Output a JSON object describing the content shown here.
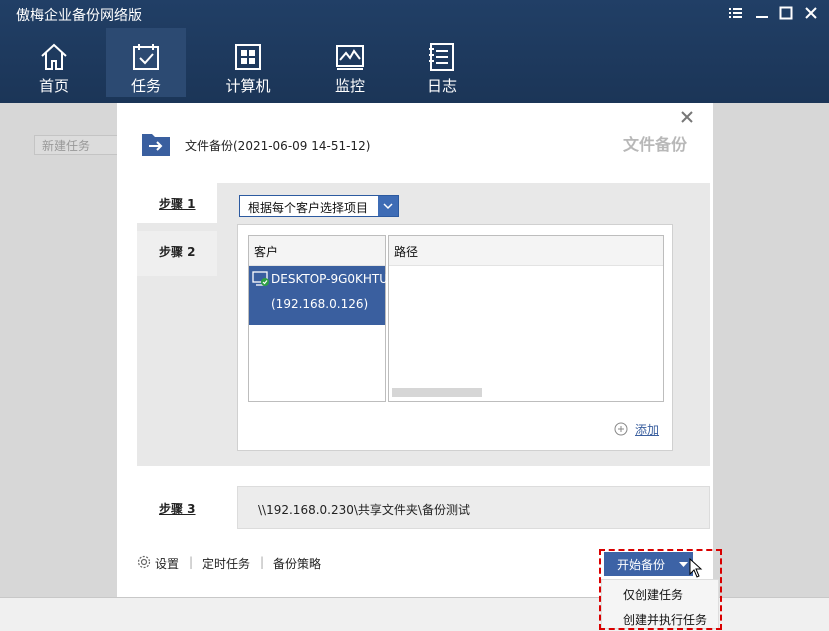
{
  "app": {
    "title": "傲梅企业备份网络版",
    "window_controls": [
      "menu",
      "minimize",
      "maximize",
      "close"
    ]
  },
  "nav": {
    "items": [
      {
        "label": "首页",
        "icon": "home-icon",
        "active": false
      },
      {
        "label": "任务",
        "icon": "task-icon",
        "active": true
      },
      {
        "label": "计算机",
        "icon": "computer-icon",
        "active": false
      },
      {
        "label": "监控",
        "icon": "monitor-icon",
        "active": false
      },
      {
        "label": "日志",
        "icon": "log-icon",
        "active": false
      }
    ]
  },
  "background": {
    "new_task_placeholder": "新建任务"
  },
  "dialog": {
    "corner_title": "文件备份",
    "task_name": "文件备份(2021-06-09 14-51-12)",
    "steps": {
      "step1_label": "步骤 1",
      "step2_label": "步骤 2",
      "step3_label": "步骤 3"
    },
    "mode_select": {
      "selected": "根据每个客户选择项目"
    },
    "client_table": {
      "header": "客户",
      "rows": [
        {
          "name": "DESKTOP-9G0KHTU",
          "ip": "(192.168.0.126)",
          "selected": true
        }
      ]
    },
    "path_table": {
      "header": "路径"
    },
    "add_label": "添加",
    "destination": "\\\\192.168.0.230\\共享文件夹\\备份测试",
    "footer": {
      "settings": "设置",
      "schedule": "定时任务",
      "strategy": "备份策略"
    },
    "start_button": "开始备份",
    "dropdown_menu": [
      "仅创建任务",
      "创建并执行任务"
    ]
  },
  "colors": {
    "titlebar": "#1e3a5f",
    "accent": "#3d63a6",
    "highlight": "#d90000"
  }
}
